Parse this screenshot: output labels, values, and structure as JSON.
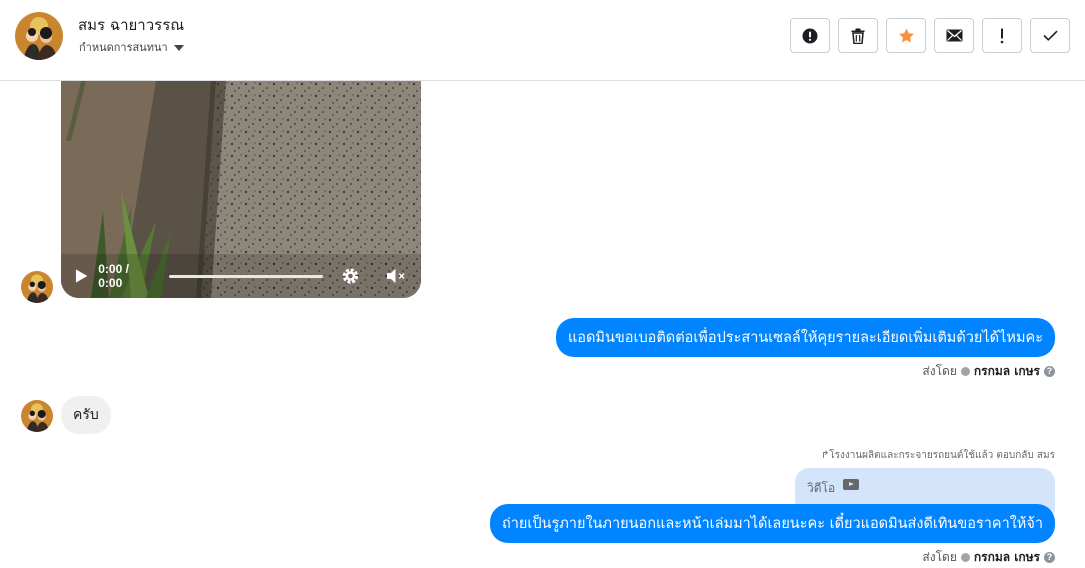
{
  "header": {
    "contact_name": "สมร ฉายาวรรณ",
    "assign_label": "กำหนดการสนทนา",
    "actions": [
      {
        "name": "report-button",
        "icon": "alert-circle-icon"
      },
      {
        "name": "delete-button",
        "icon": "trash-icon"
      },
      {
        "name": "star-button",
        "icon": "star-icon"
      },
      {
        "name": "mark-unread-button",
        "icon": "envelope-icon"
      },
      {
        "name": "important-button",
        "icon": "exclamation-icon"
      },
      {
        "name": "done-button",
        "icon": "check-icon"
      }
    ],
    "star_color": "#f7923a"
  },
  "messages": {
    "video": {
      "time": "0:00 / 0:00"
    },
    "m1": {
      "text": "แอดมินขอเบอติดต่อเพื่อประสานเซลล์ให้คุยรายละเอียดเพิ่มเติมด้วยได้ไหมคะ",
      "sent_by_label": "ส่งโดย",
      "sent_by_name": "กรกมล เกษร"
    },
    "m2": {
      "text": "ครับ"
    },
    "m3": {
      "reply_note": "โรงงานผลิตและกระจายรถยนต์ใช้แล้ว ตอบกลับ สมร",
      "quoted_label": "วิดีโอ",
      "text": "ถ่ายเป็นรูภายในภายนอกและหน้าเล่มมาได้เลยนะคะ เดี๋ยวแอดมินส่งดีเทินขอราคาให้จ้า",
      "sent_by_label": "ส่งโดย",
      "sent_by_name": "กรกมล เกษร"
    }
  },
  "colors": {
    "outgoing_bubble": "#0084ff",
    "incoming_bubble": "#f0f0f0",
    "quoted_bubble": "#d4e4fb"
  }
}
